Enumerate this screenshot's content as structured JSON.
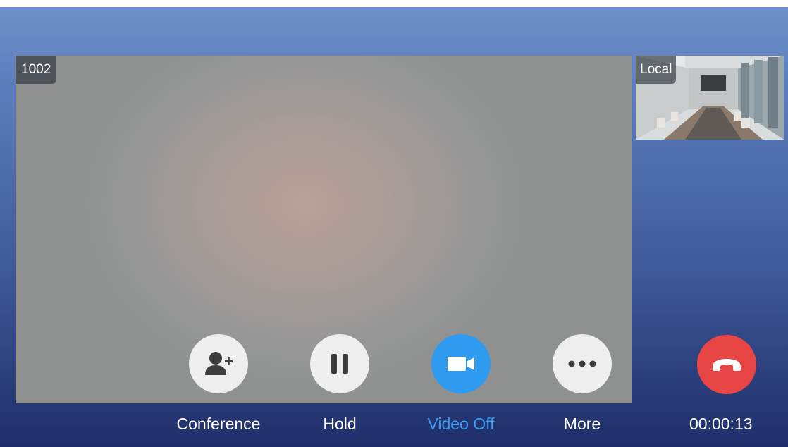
{
  "remote": {
    "label": "1002"
  },
  "local": {
    "label": "Local"
  },
  "controls": {
    "conference": {
      "label": "Conference",
      "icon": "add-person-icon"
    },
    "hold": {
      "label": "Hold",
      "icon": "pause-icon"
    },
    "video_off": {
      "label": "Video Off",
      "icon": "video-camera-icon",
      "active": true
    },
    "more": {
      "label": "More",
      "icon": "more-dots-icon"
    },
    "end_call": {
      "icon": "hang-up-icon"
    }
  },
  "timer": "00:00:13",
  "colors": {
    "accent": "#2f9bf0",
    "end_call": "#e84545",
    "button_bg": "#eeeeee"
  }
}
